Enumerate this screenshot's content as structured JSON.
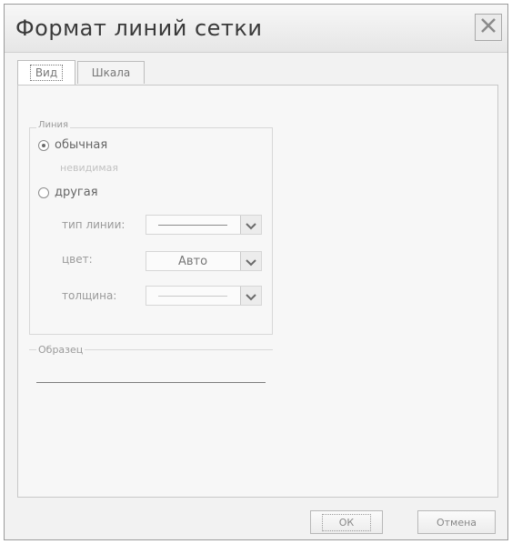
{
  "window": {
    "title": "Формат линий сетки"
  },
  "tabs": [
    {
      "label": "Вид",
      "active": true
    },
    {
      "label": "Шкала",
      "active": false
    }
  ],
  "line_group": {
    "label": "Линия",
    "options": [
      {
        "label": "обычная",
        "checked": true
      },
      {
        "label": "другая",
        "checked": false
      }
    ],
    "disabled_hint": "невидимая",
    "fields": [
      {
        "label": "тип линии:",
        "value": "",
        "kind": "line-sample"
      },
      {
        "label": "цвет:",
        "value": "Авто",
        "kind": "text"
      },
      {
        "label": "толщина:",
        "value": "",
        "kind": "line-sample-faint"
      }
    ]
  },
  "sample_group": {
    "label": "Образец"
  },
  "buttons": {
    "ok": "ОК",
    "cancel": "Отмена"
  },
  "icons": {
    "close": "close-icon",
    "dropdown": "chevron-down-icon"
  }
}
